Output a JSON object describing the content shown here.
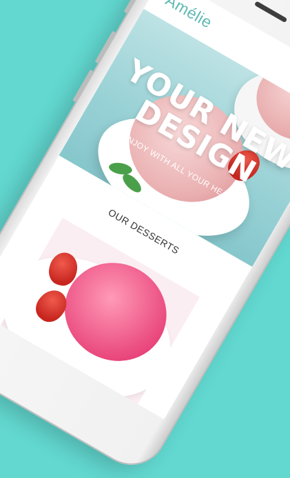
{
  "app": {
    "logo": "Amélie"
  },
  "hero": {
    "title_line1": "YOUR NEW",
    "title_line2": "DESIGN",
    "subtitle": "ENJOY WITH ALL YOUR HEART"
  },
  "section": {
    "title": "OUR DESSERTS"
  },
  "colors": {
    "background": "#62d8d0",
    "brand": "#5fb8b2",
    "hero_sky": "#9ad2d6"
  },
  "icons": {
    "menu": "hamburger-menu-icon"
  }
}
